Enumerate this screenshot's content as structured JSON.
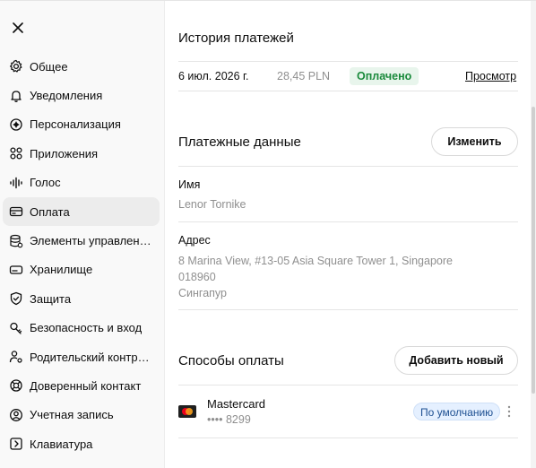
{
  "sidebar": {
    "close_icon": "close-icon",
    "items": [
      {
        "label": "Общее",
        "icon": "gear-icon"
      },
      {
        "label": "Уведомления",
        "icon": "bell-icon"
      },
      {
        "label": "Персонализация",
        "icon": "personalization-icon"
      },
      {
        "label": "Приложения",
        "icon": "apps-grid-icon"
      },
      {
        "label": "Голос",
        "icon": "voice-waveform-icon"
      },
      {
        "label": "Оплата",
        "icon": "credit-card-icon",
        "active": true
      },
      {
        "label": "Элементы управления данными",
        "icon": "database-icon"
      },
      {
        "label": "Хранилище",
        "icon": "storage-icon"
      },
      {
        "label": "Защита",
        "icon": "shield-icon"
      },
      {
        "label": "Безопасность и вход",
        "icon": "key-icon"
      },
      {
        "label": "Родительский контроль",
        "icon": "parental-control-icon"
      },
      {
        "label": "Доверенный контакт",
        "icon": "lifebuoy-icon"
      },
      {
        "label": "Учетная запись",
        "icon": "account-icon"
      },
      {
        "label": "Клавиатура",
        "icon": "keyboard-icon"
      }
    ]
  },
  "payment_history": {
    "title": "История платежей",
    "row": {
      "date": "6 июл. 2026 г.",
      "amount": "28,45 PLN",
      "status": "Оплачено",
      "view_link": "Просмотр"
    }
  },
  "billing": {
    "title": "Платежные данные",
    "change_button": "Изменить",
    "name_label": "Имя",
    "name_value": "Lenor Tornike",
    "address_label": "Адрес",
    "address_line1": "8 Marina View, #13-05 Asia Square Tower 1, Singapore",
    "address_line2": "018960",
    "address_line3": "Сингапур"
  },
  "payment_methods": {
    "title": "Способы оплаты",
    "add_button": "Добавить новый",
    "card": {
      "brand": "Mastercard",
      "number": "•••• 8299",
      "default_badge": "По умолчанию"
    }
  },
  "colors": {
    "paid_badge_bg": "#e8f5ec",
    "paid_badge_text": "#1a8a3c",
    "default_badge_bg": "#e5f0ff",
    "active_nav_bg": "#ececec"
  }
}
